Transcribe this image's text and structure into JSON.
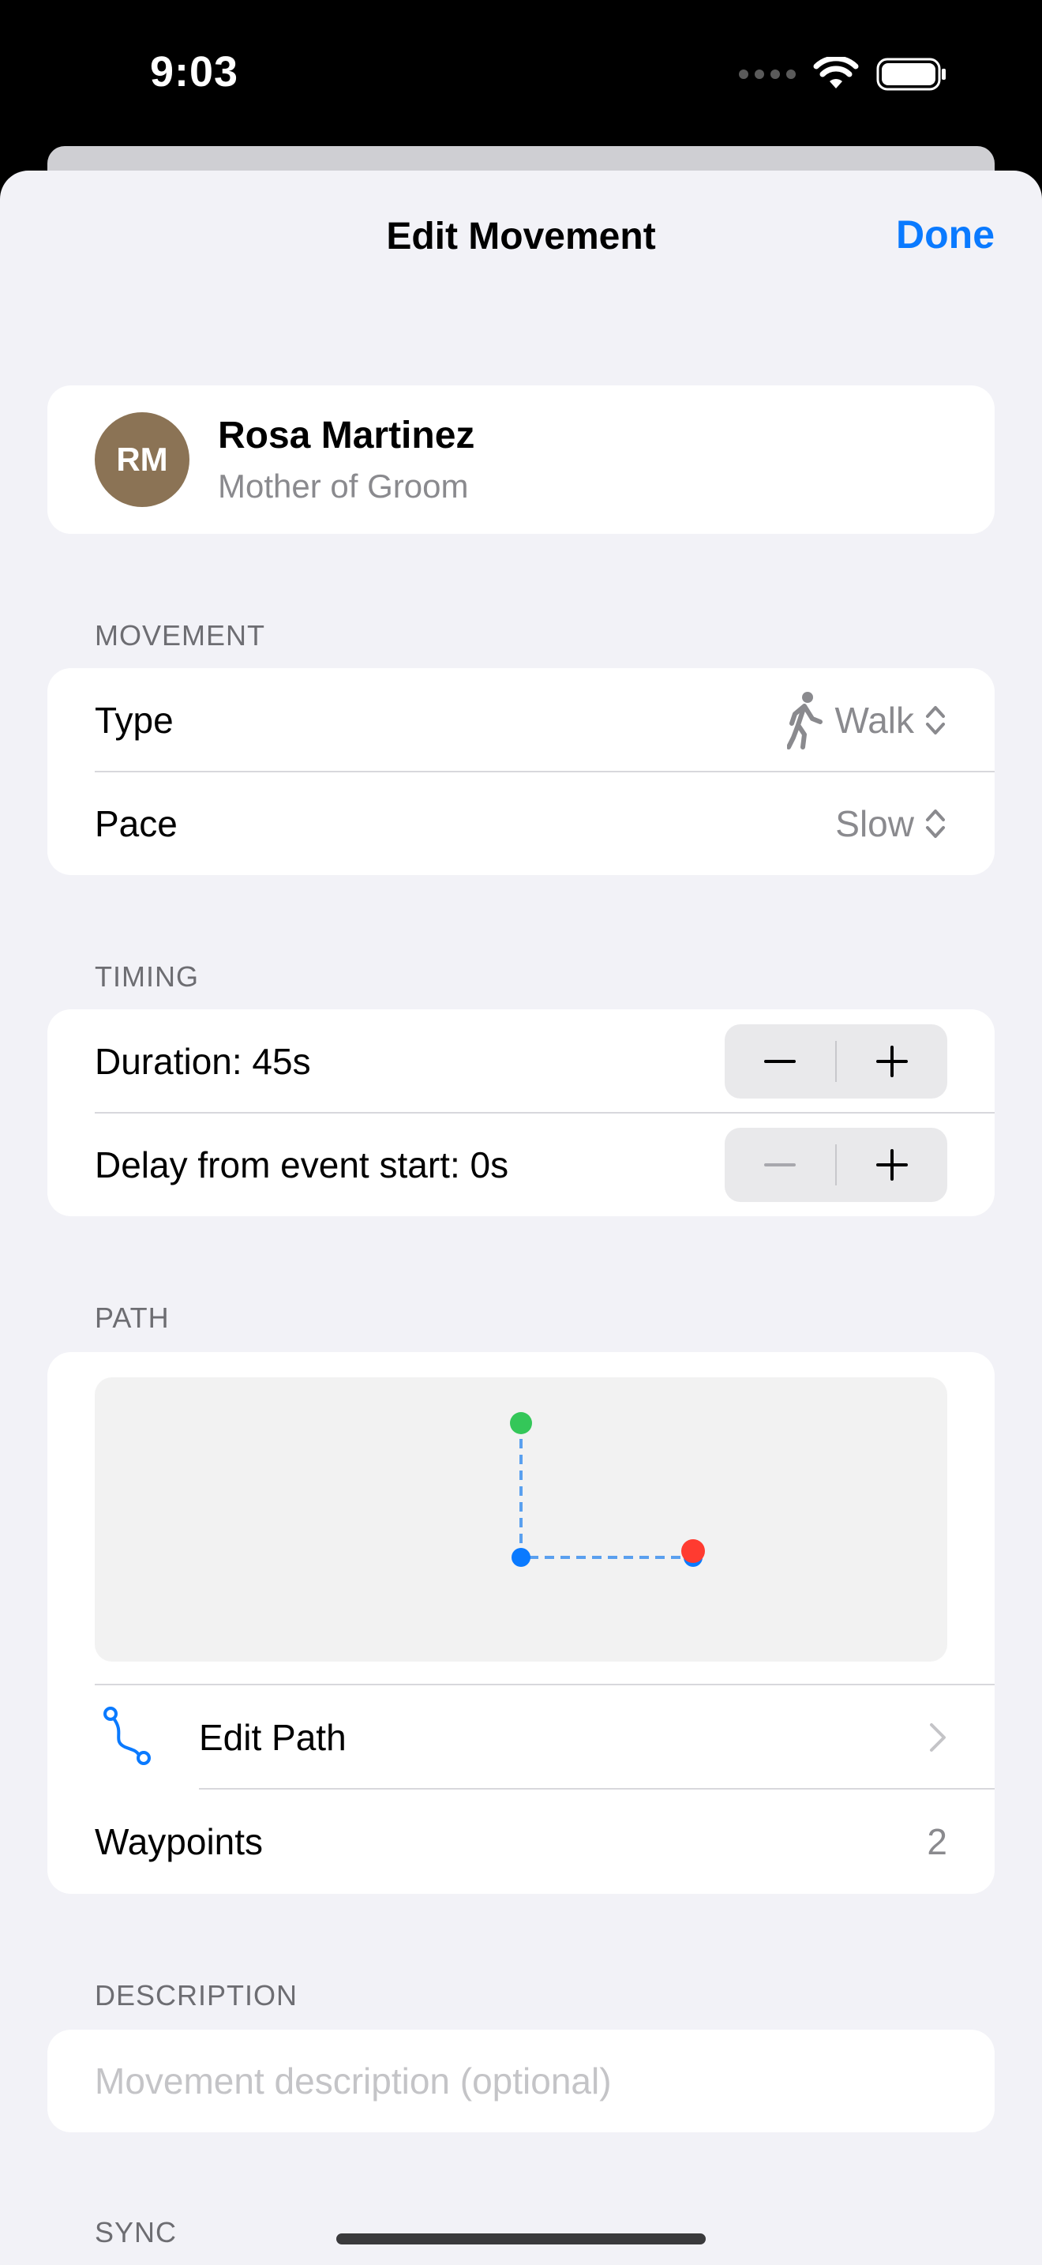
{
  "status": {
    "time": "9:03"
  },
  "nav": {
    "title": "Edit Movement",
    "done_label": "Done"
  },
  "person": {
    "initials": "RM",
    "name": "Rosa Martinez",
    "role": "Mother of Groom",
    "avatar_color": "#8b7355"
  },
  "movement": {
    "header": "MOVEMENT",
    "type_label": "Type",
    "type_value": "Walk",
    "type_icon": "walk-icon",
    "pace_label": "Pace",
    "pace_value": "Slow"
  },
  "timing": {
    "header": "TIMING",
    "duration_label": "Duration: 45s",
    "delay_label": "Delay from event start: 0s"
  },
  "path": {
    "header": "PATH",
    "edit_label": "Edit Path",
    "edit_icon": "path-icon",
    "waypoints_label": "Waypoints",
    "waypoints_value": "2",
    "start_color": "#34c759",
    "end_color": "#ff3b30",
    "point_color": "#0a7aff"
  },
  "description": {
    "header": "DESCRIPTION",
    "placeholder": "Movement description (optional)"
  },
  "sync": {
    "header": "SYNC"
  },
  "colors": {
    "accent": "#0a7aff",
    "background": "#f2f2f7"
  }
}
